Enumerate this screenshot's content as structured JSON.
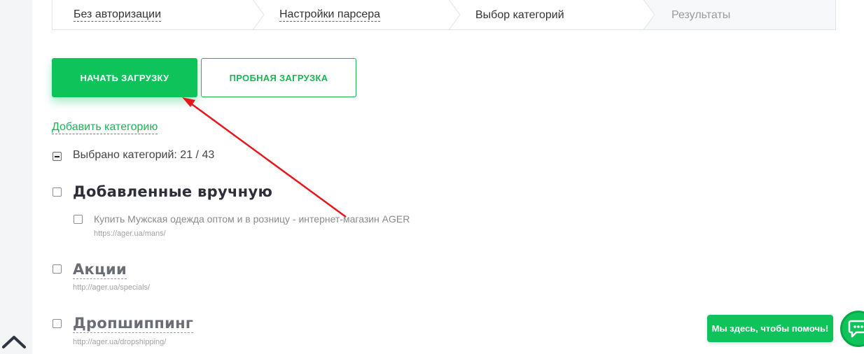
{
  "stepper": {
    "steps": [
      {
        "label": "Без авторизации"
      },
      {
        "label": "Настройки парсера"
      },
      {
        "label": "Выбор категорий"
      },
      {
        "label": "Результаты"
      }
    ]
  },
  "actions": {
    "start_label": "НАЧАТЬ ЗАГРУЗКУ",
    "trial_label": "ПРОБНАЯ ЗАГРУЗКА"
  },
  "add_category_label": "Добавить категорию",
  "selected_summary": "Выбрано категорий: 21 / 43",
  "categories": [
    {
      "title": "Добавленные вручную",
      "items": [
        {
          "title": "Купить Мужская одежда оптом и в розницу - интернет-магазин AGER",
          "url": "https://ager.ua/mans/"
        }
      ]
    },
    {
      "title": "Акции",
      "url": "http://ager.ua/specials/"
    },
    {
      "title": "Дропшиппинг",
      "url": "http://ager.ua/dropshipping/"
    }
  ],
  "help": {
    "label": "Мы здесь, чтобы помочь!"
  },
  "colors": {
    "accent": "#0ec45a",
    "annotation_arrow": "#e8161c"
  },
  "icons": {
    "scroll_top": "chevron-up-icon",
    "chat": "chat-bubble-icon"
  }
}
